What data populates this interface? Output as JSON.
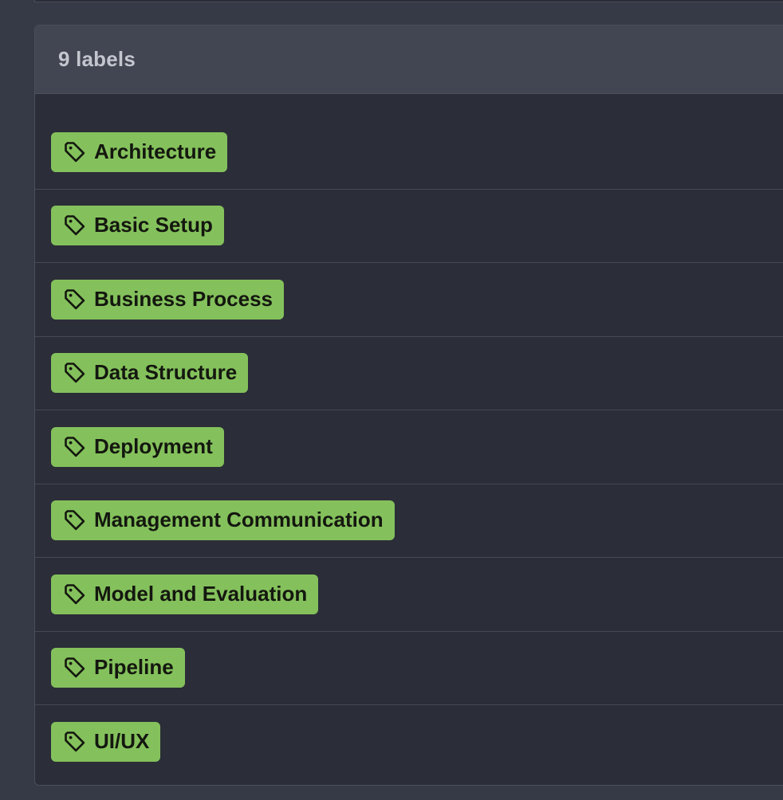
{
  "panel": {
    "title": "9 labels"
  },
  "colors": {
    "label_background": "#84c15c",
    "label_text": "#14170f",
    "panel_background": "#2b2d38",
    "header_background": "#424652"
  },
  "labels": [
    {
      "name": "Architecture",
      "icon": "tag-icon"
    },
    {
      "name": "Basic Setup",
      "icon": "tag-icon"
    },
    {
      "name": "Business Process",
      "icon": "tag-icon"
    },
    {
      "name": "Data Structure",
      "icon": "tag-icon"
    },
    {
      "name": "Deployment",
      "icon": "tag-icon"
    },
    {
      "name": "Management Communication",
      "icon": "tag-icon"
    },
    {
      "name": "Model and Evaluation",
      "icon": "tag-icon"
    },
    {
      "name": "Pipeline",
      "icon": "tag-icon"
    },
    {
      "name": "UI/UX",
      "icon": "tag-icon"
    }
  ]
}
